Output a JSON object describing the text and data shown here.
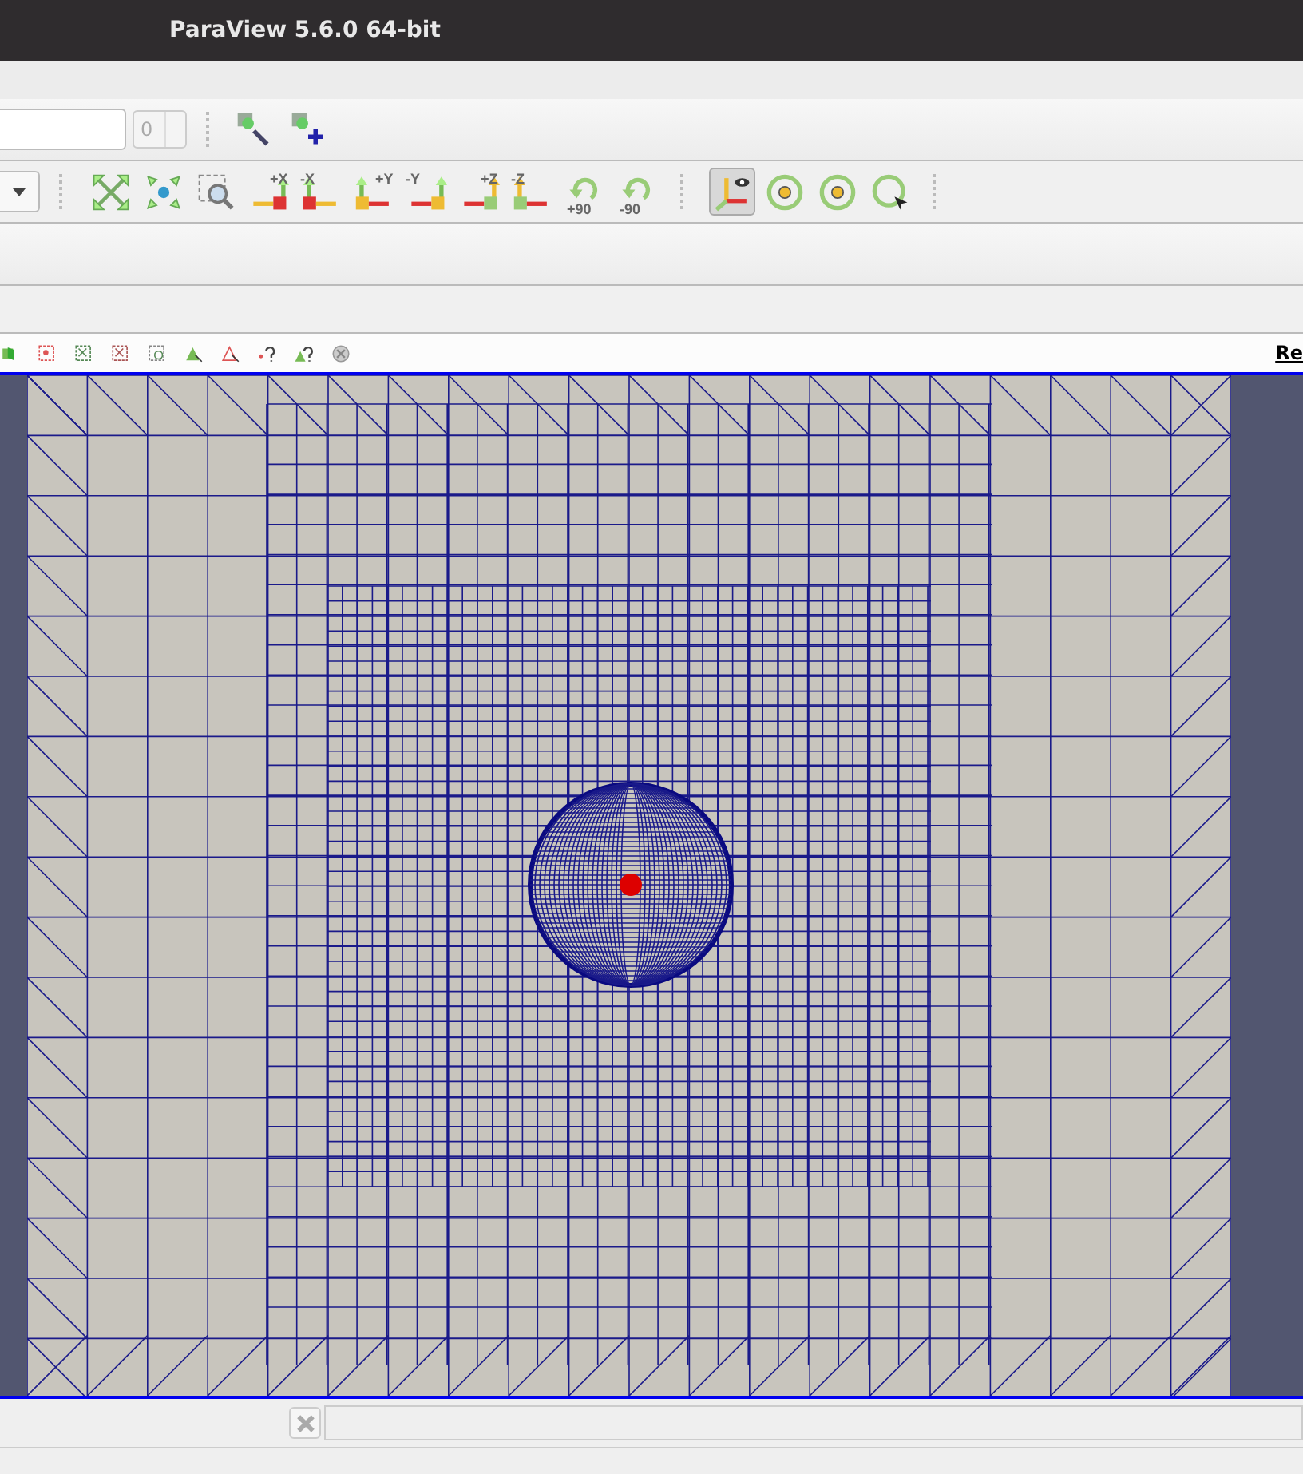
{
  "window": {
    "title": "ParaView 5.6.0 64-bit"
  },
  "time_toolbar": {
    "time_value": "0"
  },
  "camera_toolbar": {
    "buttons": [
      {
        "kind": "reset"
      },
      {
        "kind": "center"
      },
      {
        "kind": "zoom"
      },
      {
        "kind": "axis",
        "label": "+X",
        "pressed": false
      },
      {
        "kind": "axis",
        "label": "-X",
        "pressed": false
      },
      {
        "kind": "axis",
        "label": "+Y",
        "pressed": false
      },
      {
        "kind": "axis",
        "label": "-Y",
        "pressed": false
      },
      {
        "kind": "axis",
        "label": "+Z",
        "pressed": false
      },
      {
        "kind": "axis",
        "label": "-Z",
        "pressed": false
      },
      {
        "kind": "rotate",
        "label": "+90"
      },
      {
        "kind": "rotate",
        "label": "-90"
      }
    ],
    "toggles": [
      {
        "kind": "axes",
        "pressed": true
      },
      {
        "kind": "orbit",
        "pressed": false
      },
      {
        "kind": "orbit",
        "pressed": false
      },
      {
        "kind": "pick",
        "pressed": false
      }
    ]
  },
  "view_toolbar": {
    "link_text": "Re"
  }
}
